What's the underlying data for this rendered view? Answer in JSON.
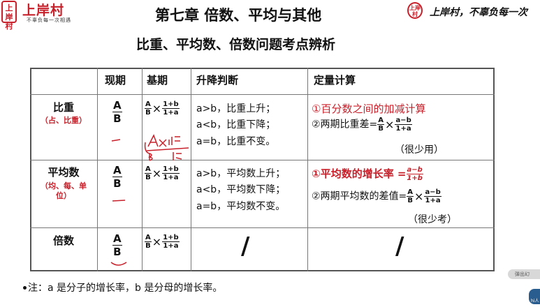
{
  "header": {
    "logo_text": "上岸村",
    "brand": "上岸村",
    "brand_slogan": "不辜负每一次相遇",
    "chapter_title": "第七章 倍数、平均与其他",
    "subtitle": "比重、平均数、倍数问题考点辨析",
    "right_logo_text": "上岸村",
    "right_slogan": "上岸村，不辜负每一次"
  },
  "table": {
    "headers": [
      "现期",
      "基期",
      "升降判断",
      "定量计算"
    ],
    "rows": [
      {
        "label": "比重",
        "sub": "（占、比重）",
        "current": {
          "num": "A",
          "den": "B"
        },
        "base": {
          "a": "A",
          "b": "B",
          "c": "1+b",
          "d": "1+a"
        },
        "judge": [
          "a>b，比重上升；",
          "a<b，比重下降；",
          "a=b，比重不变。"
        ],
        "calc1": "①百分数之间的加减计算",
        "calc2_prefix": "②两期比重差=",
        "calc2_frac1": {
          "num": "A",
          "den": "B"
        },
        "calc2_frac2": {
          "num": "a−b",
          "den": "1+a"
        },
        "calc_note": "（很少用）"
      },
      {
        "label": "平均数",
        "sub": "（均、每、单位）",
        "current": {
          "num": "A",
          "den": "B"
        },
        "base": {
          "a": "A",
          "b": "B",
          "c": "1+b",
          "d": "1+a"
        },
        "judge": [
          "a>b，平均数上升；",
          "a<b，平均数下降；",
          "a=b，平均数不变。"
        ],
        "calc1": "①平均数的增长率 =",
        "calc1_frac": {
          "num": "a−b",
          "den": "1+b"
        },
        "calc2_prefix": "②两期平均数的差值=",
        "calc2_frac1": {
          "num": "A",
          "den": "B"
        },
        "calc2_frac2": {
          "num": "a−b",
          "den": "1+a"
        },
        "calc_note": "（很少考）"
      },
      {
        "label": "倍数",
        "current": {
          "num": "A",
          "den": "B"
        },
        "base": {
          "a": "A",
          "b": "B",
          "c": "1+b",
          "d": "1+a"
        },
        "judge_slash": "/",
        "calc_slash": "/"
      }
    ]
  },
  "note": "注：a 是分子的增长率，b 是分母的增长率。",
  "side_button": "弹出幻",
  "avatar_label": "hi人"
}
